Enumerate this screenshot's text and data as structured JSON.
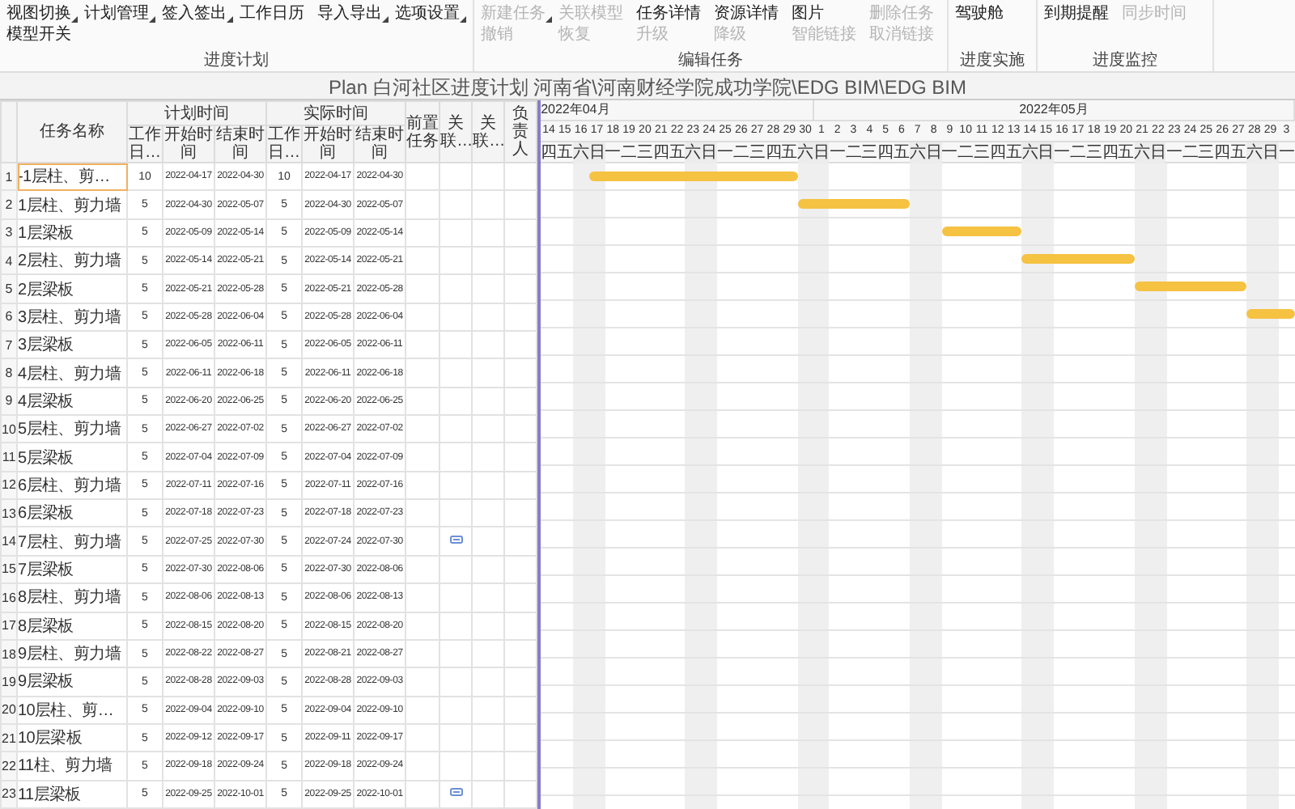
{
  "toolbar": {
    "groups": [
      {
        "label": "进度计划",
        "buttons": [
          {
            "label": "视图切换",
            "disabled": false,
            "dropdown": true
          },
          {
            "label": "计划管理",
            "disabled": false,
            "dropdown": true
          },
          {
            "label": "签入签出",
            "disabled": false,
            "dropdown": true
          },
          {
            "label": "工作日历",
            "disabled": false,
            "dropdown": false
          },
          {
            "label": "导入导出",
            "disabled": false,
            "dropdown": true
          },
          {
            "label": "选项设置",
            "disabled": false,
            "dropdown": true
          },
          {
            "label": "模型开关",
            "disabled": false,
            "dropdown": false
          }
        ]
      },
      {
        "label": "编辑任务",
        "buttons": [
          {
            "label": "新建任务",
            "disabled": true,
            "dropdown": true
          },
          {
            "label": "关联模型",
            "disabled": true,
            "dropdown": false
          },
          {
            "label": "任务详情",
            "disabled": false,
            "dropdown": false
          },
          {
            "label": "资源详情",
            "disabled": false,
            "dropdown": false
          },
          {
            "label": "图片",
            "disabled": false,
            "dropdown": false
          },
          {
            "label": "删除任务",
            "disabled": true,
            "dropdown": false
          },
          {
            "label": "撤销",
            "disabled": true,
            "dropdown": false
          },
          {
            "label": "恢复",
            "disabled": true,
            "dropdown": false
          },
          {
            "label": "升级",
            "disabled": true,
            "dropdown": false
          },
          {
            "label": "降级",
            "disabled": true,
            "dropdown": false
          },
          {
            "label": "智能链接",
            "disabled": true,
            "dropdown": false
          },
          {
            "label": "取消链接",
            "disabled": true,
            "dropdown": false
          }
        ]
      },
      {
        "label": "进度实施",
        "buttons": [
          {
            "label": "驾驶舱",
            "disabled": false,
            "dropdown": false
          }
        ]
      },
      {
        "label": "进度监控",
        "buttons": [
          {
            "label": "到期提醒",
            "disabled": false,
            "dropdown": false
          },
          {
            "label": "同步时间",
            "disabled": true,
            "dropdown": false
          }
        ]
      }
    ]
  },
  "title": "Plan 白河社区进度计划 河南省\\河南财经学院成功学院\\EDG BIM\\EDG BIM",
  "table": {
    "columns": {
      "task_name": "任务名称",
      "plan_group": "计划时间",
      "actual_group": "实际时间",
      "plan_sub": [
        "工作日…",
        "开始时间",
        "结束时间"
      ],
      "actual_sub": [
        "工作日…",
        "开始时间",
        "结束时间"
      ],
      "predecessor": "前置任务",
      "related_1": "关联…",
      "related_2": "关联…",
      "owner": "负责人"
    },
    "rows": [
      {
        "index": "1",
        "name": "-1层柱、剪…",
        "plan_days": "10",
        "plan_start": "2022-04-17",
        "plan_end": "2022-04-30",
        "actual_days": "10",
        "actual_start": "2022-04-17",
        "actual_end": "2022-04-30",
        "linked": false,
        "selected": true
      },
      {
        "index": "2",
        "name": "1层柱、剪力墙",
        "plan_days": "5",
        "plan_start": "2022-04-30",
        "plan_end": "2022-05-07",
        "actual_days": "5",
        "actual_start": "2022-04-30",
        "actual_end": "2022-05-07",
        "linked": false,
        "selected": false
      },
      {
        "index": "3",
        "name": "1层梁板",
        "plan_days": "5",
        "plan_start": "2022-05-09",
        "plan_end": "2022-05-14",
        "actual_days": "5",
        "actual_start": "2022-05-09",
        "actual_end": "2022-05-14",
        "linked": false,
        "selected": false
      },
      {
        "index": "4",
        "name": "2层柱、剪力墙",
        "plan_days": "5",
        "plan_start": "2022-05-14",
        "plan_end": "2022-05-21",
        "actual_days": "5",
        "actual_start": "2022-05-14",
        "actual_end": "2022-05-21",
        "linked": false,
        "selected": false
      },
      {
        "index": "5",
        "name": "2层梁板",
        "plan_days": "5",
        "plan_start": "2022-05-21",
        "plan_end": "2022-05-28",
        "actual_days": "5",
        "actual_start": "2022-05-21",
        "actual_end": "2022-05-28",
        "linked": false,
        "selected": false
      },
      {
        "index": "6",
        "name": "3层柱、剪力墙",
        "plan_days": "5",
        "plan_start": "2022-05-28",
        "plan_end": "2022-06-04",
        "actual_days": "5",
        "actual_start": "2022-05-28",
        "actual_end": "2022-06-04",
        "linked": false,
        "selected": false
      },
      {
        "index": "7",
        "name": "3层梁板",
        "plan_days": "5",
        "plan_start": "2022-06-05",
        "plan_end": "2022-06-11",
        "actual_days": "5",
        "actual_start": "2022-06-05",
        "actual_end": "2022-06-11",
        "linked": false,
        "selected": false
      },
      {
        "index": "8",
        "name": "4层柱、剪力墙",
        "plan_days": "5",
        "plan_start": "2022-06-11",
        "plan_end": "2022-06-18",
        "actual_days": "5",
        "actual_start": "2022-06-11",
        "actual_end": "2022-06-18",
        "linked": false,
        "selected": false
      },
      {
        "index": "9",
        "name": "4层梁板",
        "plan_days": "5",
        "plan_start": "2022-06-20",
        "plan_end": "2022-06-25",
        "actual_days": "5",
        "actual_start": "2022-06-20",
        "actual_end": "2022-06-25",
        "linked": false,
        "selected": false
      },
      {
        "index": "10",
        "name": "5层柱、剪力墙",
        "plan_days": "5",
        "plan_start": "2022-06-27",
        "plan_end": "2022-07-02",
        "actual_days": "5",
        "actual_start": "2022-06-27",
        "actual_end": "2022-07-02",
        "linked": false,
        "selected": false
      },
      {
        "index": "11",
        "name": "5层梁板",
        "plan_days": "5",
        "plan_start": "2022-07-04",
        "plan_end": "2022-07-09",
        "actual_days": "5",
        "actual_start": "2022-07-04",
        "actual_end": "2022-07-09",
        "linked": false,
        "selected": false
      },
      {
        "index": "12",
        "name": "6层柱、剪力墙",
        "plan_days": "5",
        "plan_start": "2022-07-11",
        "plan_end": "2022-07-16",
        "actual_days": "5",
        "actual_start": "2022-07-11",
        "actual_end": "2022-07-16",
        "linked": false,
        "selected": false
      },
      {
        "index": "13",
        "name": "6层梁板",
        "plan_days": "5",
        "plan_start": "2022-07-18",
        "plan_end": "2022-07-23",
        "actual_days": "5",
        "actual_start": "2022-07-18",
        "actual_end": "2022-07-23",
        "linked": false,
        "selected": false
      },
      {
        "index": "14",
        "name": "7层柱、剪力墙",
        "plan_days": "5",
        "plan_start": "2022-07-25",
        "plan_end": "2022-07-30",
        "actual_days": "5",
        "actual_start": "2022-07-24",
        "actual_end": "2022-07-30",
        "linked": true,
        "selected": false
      },
      {
        "index": "15",
        "name": "7层梁板",
        "plan_days": "5",
        "plan_start": "2022-07-30",
        "plan_end": "2022-08-06",
        "actual_days": "5",
        "actual_start": "2022-07-30",
        "actual_end": "2022-08-06",
        "linked": false,
        "selected": false
      },
      {
        "index": "16",
        "name": "8层柱、剪力墙",
        "plan_days": "5",
        "plan_start": "2022-08-06",
        "plan_end": "2022-08-13",
        "actual_days": "5",
        "actual_start": "2022-08-06",
        "actual_end": "2022-08-13",
        "linked": false,
        "selected": false
      },
      {
        "index": "17",
        "name": "8层梁板",
        "plan_days": "5",
        "plan_start": "2022-08-15",
        "plan_end": "2022-08-20",
        "actual_days": "5",
        "actual_start": "2022-08-15",
        "actual_end": "2022-08-20",
        "linked": false,
        "selected": false
      },
      {
        "index": "18",
        "name": "9层柱、剪力墙",
        "plan_days": "5",
        "plan_start": "2022-08-22",
        "plan_end": "2022-08-27",
        "actual_days": "5",
        "actual_start": "2022-08-21",
        "actual_end": "2022-08-27",
        "linked": false,
        "selected": false
      },
      {
        "index": "19",
        "name": "9层梁板",
        "plan_days": "5",
        "plan_start": "2022-08-28",
        "plan_end": "2022-09-03",
        "actual_days": "5",
        "actual_start": "2022-08-28",
        "actual_end": "2022-09-03",
        "linked": false,
        "selected": false
      },
      {
        "index": "20",
        "name": "10层柱、剪…",
        "plan_days": "5",
        "plan_start": "2022-09-04",
        "plan_end": "2022-09-10",
        "actual_days": "5",
        "actual_start": "2022-09-04",
        "actual_end": "2022-09-10",
        "linked": false,
        "selected": false
      },
      {
        "index": "21",
        "name": "10层梁板",
        "plan_days": "5",
        "plan_start": "2022-09-12",
        "plan_end": "2022-09-17",
        "actual_days": "5",
        "actual_start": "2022-09-11",
        "actual_end": "2022-09-17",
        "linked": false,
        "selected": false
      },
      {
        "index": "22",
        "name": "11柱、剪力墙",
        "plan_days": "5",
        "plan_start": "2022-09-18",
        "plan_end": "2022-09-24",
        "actual_days": "5",
        "actual_start": "2022-09-18",
        "actual_end": "2022-09-24",
        "linked": false,
        "selected": false
      },
      {
        "index": "23",
        "name": "11层梁板",
        "plan_days": "5",
        "plan_start": "2022-09-25",
        "plan_end": "2022-10-01",
        "actual_days": "5",
        "actual_start": "2022-09-25",
        "actual_end": "2022-10-01",
        "linked": true,
        "selected": false
      }
    ]
  },
  "gantt": {
    "months": [
      {
        "label": "2022年04月",
        "days": [
          {
            "day": "14",
            "weekday": "四",
            "weekend": false
          },
          {
            "day": "15",
            "weekday": "五",
            "weekend": false
          },
          {
            "day": "16",
            "weekday": "六",
            "weekend": true
          },
          {
            "day": "17",
            "weekday": "日",
            "weekend": true
          },
          {
            "day": "18",
            "weekday": "一",
            "weekend": false
          },
          {
            "day": "19",
            "weekday": "二",
            "weekend": false
          },
          {
            "day": "20",
            "weekday": "三",
            "weekend": false
          },
          {
            "day": "21",
            "weekday": "四",
            "weekend": false
          },
          {
            "day": "22",
            "weekday": "五",
            "weekend": false
          },
          {
            "day": "23",
            "weekday": "六",
            "weekend": true
          },
          {
            "day": "24",
            "weekday": "日",
            "weekend": true
          },
          {
            "day": "25",
            "weekday": "一",
            "weekend": false
          },
          {
            "day": "26",
            "weekday": "二",
            "weekend": false
          },
          {
            "day": "27",
            "weekday": "三",
            "weekend": false
          },
          {
            "day": "28",
            "weekday": "四",
            "weekend": false
          },
          {
            "day": "29",
            "weekday": "五",
            "weekend": false
          },
          {
            "day": "30",
            "weekday": "六",
            "weekend": true
          }
        ]
      },
      {
        "label": "2022年05月",
        "days": [
          {
            "day": "1",
            "weekday": "日",
            "weekend": true
          },
          {
            "day": "2",
            "weekday": "一",
            "weekend": false
          },
          {
            "day": "3",
            "weekday": "二",
            "weekend": false
          },
          {
            "day": "4",
            "weekday": "三",
            "weekend": false
          },
          {
            "day": "5",
            "weekday": "四",
            "weekend": false
          },
          {
            "day": "6",
            "weekday": "五",
            "weekend": false
          },
          {
            "day": "7",
            "weekday": "六",
            "weekend": true
          },
          {
            "day": "8",
            "weekday": "日",
            "weekend": true
          },
          {
            "day": "9",
            "weekday": "一",
            "weekend": false
          },
          {
            "day": "10",
            "weekday": "二",
            "weekend": false
          },
          {
            "day": "11",
            "weekday": "三",
            "weekend": false
          },
          {
            "day": "12",
            "weekday": "四",
            "weekend": false
          },
          {
            "day": "13",
            "weekday": "五",
            "weekend": false
          },
          {
            "day": "14",
            "weekday": "六",
            "weekend": true
          },
          {
            "day": "15",
            "weekday": "日",
            "weekend": true
          },
          {
            "day": "16",
            "weekday": "一",
            "weekend": false
          },
          {
            "day": "17",
            "weekday": "二",
            "weekend": false
          },
          {
            "day": "18",
            "weekday": "三",
            "weekend": false
          },
          {
            "day": "19",
            "weekday": "四",
            "weekend": false
          },
          {
            "day": "20",
            "weekday": "五",
            "weekend": false
          },
          {
            "day": "21",
            "weekday": "六",
            "weekend": true
          },
          {
            "day": "22",
            "weekday": "日",
            "weekend": true
          },
          {
            "day": "23",
            "weekday": "一",
            "weekend": false
          },
          {
            "day": "24",
            "weekday": "二",
            "weekend": false
          },
          {
            "day": "25",
            "weekday": "三",
            "weekend": false
          },
          {
            "day": "26",
            "weekday": "四",
            "weekend": false
          },
          {
            "day": "27",
            "weekday": "五",
            "weekend": false
          },
          {
            "day": "28",
            "weekday": "六",
            "weekend": true
          },
          {
            "day": "29",
            "weekday": "日",
            "weekend": true
          },
          {
            "day": "3",
            "weekday": "一",
            "weekend": false
          }
        ]
      }
    ]
  }
}
